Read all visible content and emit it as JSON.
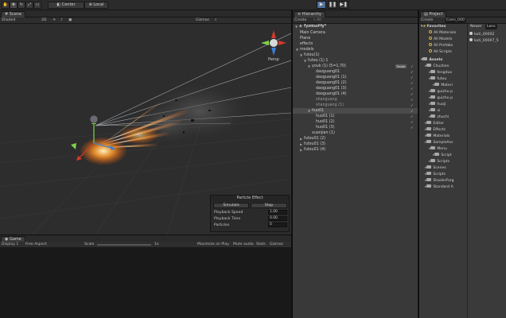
{
  "toolbar": {
    "center_label": "Center",
    "local_label": "Local"
  },
  "scene": {
    "tab_label": "Scene",
    "shaded_label": "Shaded",
    "mode_2d_label": "2D",
    "gizmos_label": "Gizmos",
    "persp_label": "Persp"
  },
  "particle_effect": {
    "title": "Particle Effect",
    "simulate_label": "Simulate",
    "stop_label": "Stop",
    "playback_speed_label": "Playback Speed",
    "playback_speed_value": "1.00",
    "playback_time_label": "Playback Time",
    "playback_time_value": "0.00",
    "particles_label": "Particles",
    "particles_value": "0"
  },
  "game": {
    "tab_label": "Game",
    "display_label": "Display 1",
    "aspect_label": "Free Aspect",
    "scale_label": "Scale",
    "scale_value": "1x",
    "maximize_label": "Maximize on Play",
    "mute_label": "Mute audio",
    "stats_label": "Stats",
    "gizmos_label": "Gizmos"
  },
  "hierarchy": {
    "tab_label": "Hierarchy",
    "create_label": "Create",
    "all_label": "All",
    "scene_name": "fyzmu#fy*",
    "items": [
      {
        "label": "Main Camera"
      },
      {
        "label": "Plane"
      },
      {
        "label": "effects"
      },
      {
        "label": "models"
      },
      {
        "label": "futou(1)"
      },
      {
        "label": "futou (1) 1"
      },
      {
        "label": "youk (1) (5=1,70)",
        "tag": "Trailer"
      },
      {
        "label": "daoguang01"
      },
      {
        "label": "daoguang01 (1)"
      },
      {
        "label": "daoguang01 (2)"
      },
      {
        "label": "daoguang01 (3)"
      },
      {
        "label": "daoguang01 (4)"
      },
      {
        "label": "shanguang"
      },
      {
        "label": "shanguang (1)"
      },
      {
        "label": "huo01"
      },
      {
        "label": "huo01 (1)"
      },
      {
        "label": "huo01 (2)"
      },
      {
        "label": "huo01 (3)"
      },
      {
        "label": "xuanjian (1)"
      },
      {
        "label": "futou01 (2)"
      },
      {
        "label": "futou01 (3)"
      },
      {
        "label": "futou01 (4)"
      }
    ]
  },
  "project": {
    "tab_label": "Project",
    "create_label": "Create",
    "search_value": "Coen_000",
    "favorites_label": "Favorites",
    "favorites": [
      "All Materials",
      "All Models",
      "All Prefabs",
      "All Scripts"
    ],
    "assets_label": "Assets",
    "folders": [
      {
        "label": "Chuzhen"
      },
      {
        "label": "fengduo"
      },
      {
        "label": "futou"
      },
      {
        "label": "Materi"
      },
      {
        "label": "guizhu p"
      },
      {
        "label": "guizhu p"
      },
      {
        "label": "huoji"
      },
      {
        "label": "xi"
      },
      {
        "label": "zhuchi"
      },
      {
        "label": "Editor"
      },
      {
        "label": "Effects"
      },
      {
        "label": "Materials"
      },
      {
        "label": "SampleAss"
      },
      {
        "label": "Menu"
      },
      {
        "label": "Script"
      },
      {
        "label": "Scripts"
      },
      {
        "label": "Scenes"
      },
      {
        "label": "Scripts"
      },
      {
        "label": "ShaderForg"
      },
      {
        "label": "Standard A"
      }
    ],
    "list_header": "Newer",
    "list_search": "Lens",
    "list_items": [
      "kuti_00002",
      "kuti_00007_5"
    ]
  },
  "colors": {
    "accent": "#2f4f76",
    "panel": "#393939",
    "scene_bg": "#2d2d2d"
  }
}
